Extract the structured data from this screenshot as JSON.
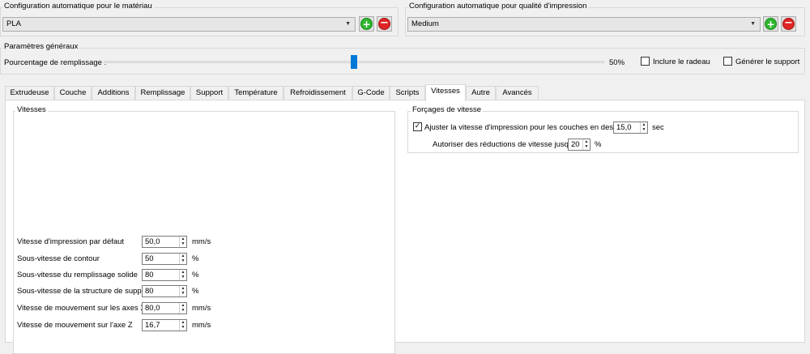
{
  "material": {
    "group_title": "Configuration automatique pour le matériau",
    "selected": "PLA"
  },
  "quality": {
    "group_title": "Configuration automatique pour qualité d'impression",
    "selected": "Medium"
  },
  "general": {
    "group_title": "Paramètres généraux",
    "infill_label": "Pourcentage de remplissage :",
    "infill_value_text": "50%",
    "infill_fraction": 0.5,
    "raft_label": "Inclure le radeau",
    "raft_checked": false,
    "support_label": "Générer le support",
    "support_checked": false
  },
  "tabs": [
    "Extrudeuse",
    "Couche",
    "Additions",
    "Remplissage",
    "Support",
    "Température",
    "Refroidissement",
    "G-Code",
    "Scripts",
    "Vitesses",
    "Autre",
    "Avancés"
  ],
  "active_tab": "Vitesses",
  "speeds": {
    "group_title": "Vitesses",
    "rows": [
      {
        "label": "Vitesse d'impression par défaut",
        "value": "50,0",
        "unit": "mm/s"
      },
      {
        "label": "Sous-vitesse de contour",
        "value": "50",
        "unit": "%"
      },
      {
        "label": "Sous-vitesse du remplissage solide",
        "value": "80",
        "unit": "%"
      },
      {
        "label": "Sous-vitesse de la structure de support",
        "value": "80",
        "unit": "%"
      },
      {
        "label": "Vitesse de mouvement sur les axes X/Y",
        "value": "80,0",
        "unit": "mm/s"
      },
      {
        "label": "Vitesse de mouvement sur l'axe Z",
        "value": "16,7",
        "unit": "mm/s"
      }
    ]
  },
  "overrides": {
    "group_title": "Forçages de vitesse",
    "adjust_label": "Ajuster la vitesse d'impression pour les couches en dessous",
    "adjust_checked": true,
    "adjust_value": "15,0",
    "adjust_unit": "sec",
    "reduce_label": "Autoriser des réductions de vitesse jusqu'à",
    "reduce_value": "20",
    "reduce_unit": "%"
  },
  "icons": {
    "add": "+",
    "remove": "−",
    "dropdown": "▼",
    "spin_up": "▲",
    "spin_down": "▼",
    "check": "✓"
  }
}
